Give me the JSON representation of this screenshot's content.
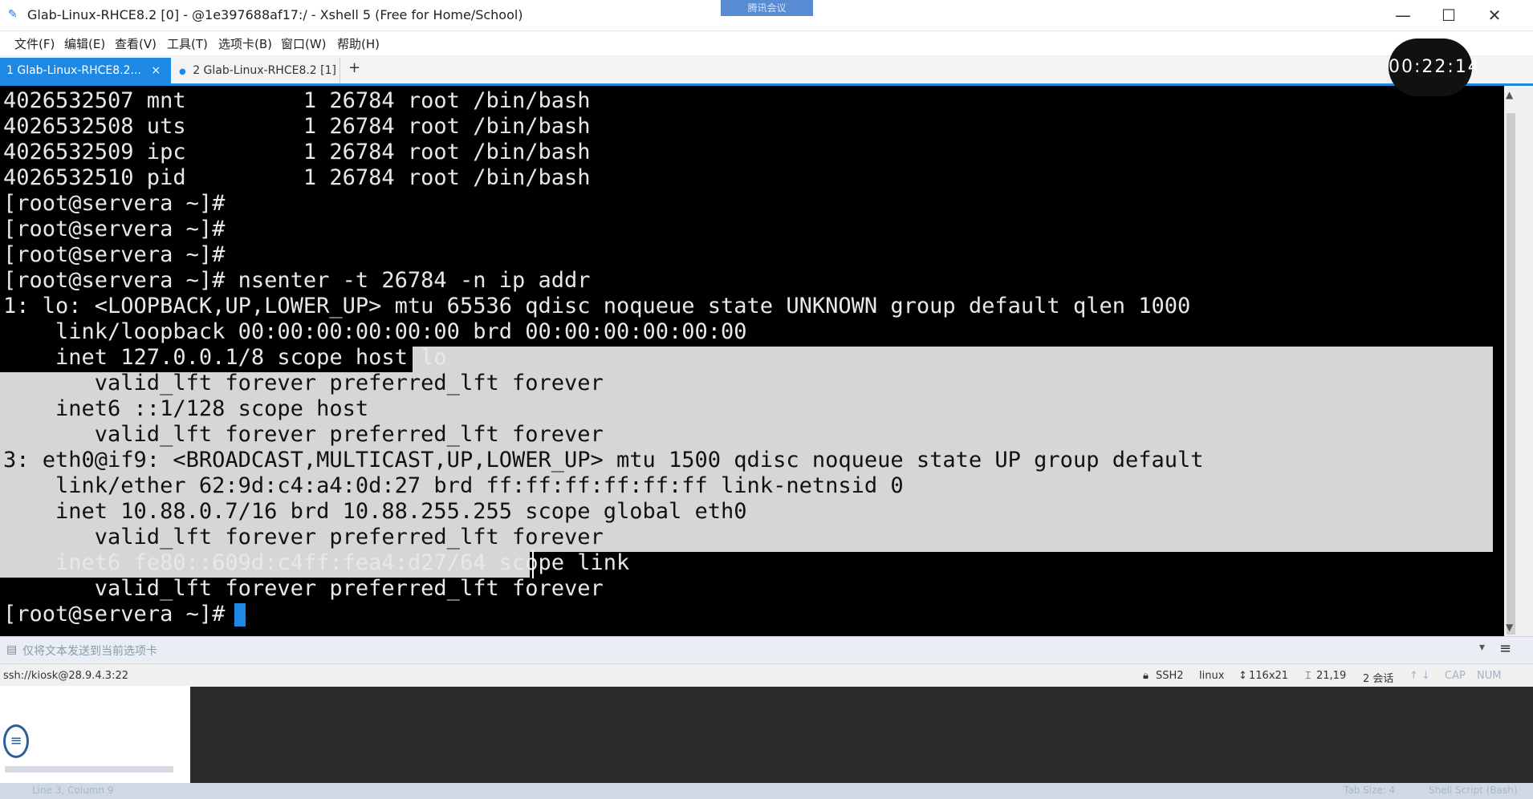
{
  "window": {
    "title": "Glab-Linux-RHCE8.2 [0] - @1e397688af17:/ - Xshell 5 (Free for Home/School)",
    "minimize": "—",
    "maximize": "☐",
    "close": "✕"
  },
  "overlay_badge": "腾讯会议",
  "menu": [
    "文件(F)",
    "编辑(E)",
    "查看(V)",
    "工具(T)",
    "选项卡(B)",
    "窗口(W)",
    "帮助(H)"
  ],
  "tabs": [
    {
      "label": "1 Glab-Linux-RHCE8.2...",
      "close": "×"
    },
    {
      "label": "2 Glab-Linux-RHCE8.2 [1]",
      "close": "×"
    }
  ],
  "tab_add": "+",
  "bubble_text": "00:22:14",
  "terminal": {
    "lines": [
      "4026532507 mnt         1 26784 root /bin/bash",
      "4026532508 uts         1 26784 root /bin/bash",
      "4026532509 ipc         1 26784 root /bin/bash",
      "4026532510 pid         1 26784 root /bin/bash",
      "[root@servera ~]#",
      "[root@servera ~]#",
      "[root@servera ~]#",
      "[root@servera ~]# nsenter -t 26784 -n ip addr",
      "1: lo: <LOOPBACK,UP,LOWER_UP> mtu 65536 qdisc noqueue state UNKNOWN group default qlen 1000",
      "    link/loopback 00:00:00:00:00:00 brd 00:00:00:00:00:00",
      "    inet 127.0.0.1/8 scope host lo",
      "       valid_lft forever preferred_lft forever",
      "    inet6 ::1/128 scope host",
      "       valid_lft forever preferred_lft forever",
      "3: eth0@if9: <BROADCAST,MULTICAST,UP,LOWER_UP> mtu 1500 qdisc noqueue state UP group default",
      "    link/ether 62:9d:c4:a4:0d:27 brd ff:ff:ff:ff:ff:ff link-netnsid 0",
      "    inet 10.88.0.7/16 brd 10.88.255.255 scope global eth0",
      "       valid_lft forever preferred_lft forever",
      "    inet6 fe80::609d:c4ff:fea4:d27/64 scope link",
      "       valid_lft forever preferred_lft forever",
      "[root@servera ~]# "
    ]
  },
  "compose_bar": {
    "text": "仅将文本发送到当前选项卡"
  },
  "status": {
    "connection": "ssh://kiosk@28.9.4.3:22",
    "protocol": "SSH2",
    "term": "linux",
    "size": "116x21",
    "cursor_pos": "21,19",
    "sessions": "2 会话",
    "cap": "CAP",
    "num": "NUM"
  },
  "editor_status": {
    "position": "Line 3, Column 9",
    "tab_size": "Tab Size: 4",
    "syntax": "Shell Script (Bash)"
  },
  "colors": {
    "accent": "#1e88e5",
    "terminal_bg": "#000000",
    "terminal_fg": "#e8e8e8",
    "selection": "#d6d6d6"
  }
}
